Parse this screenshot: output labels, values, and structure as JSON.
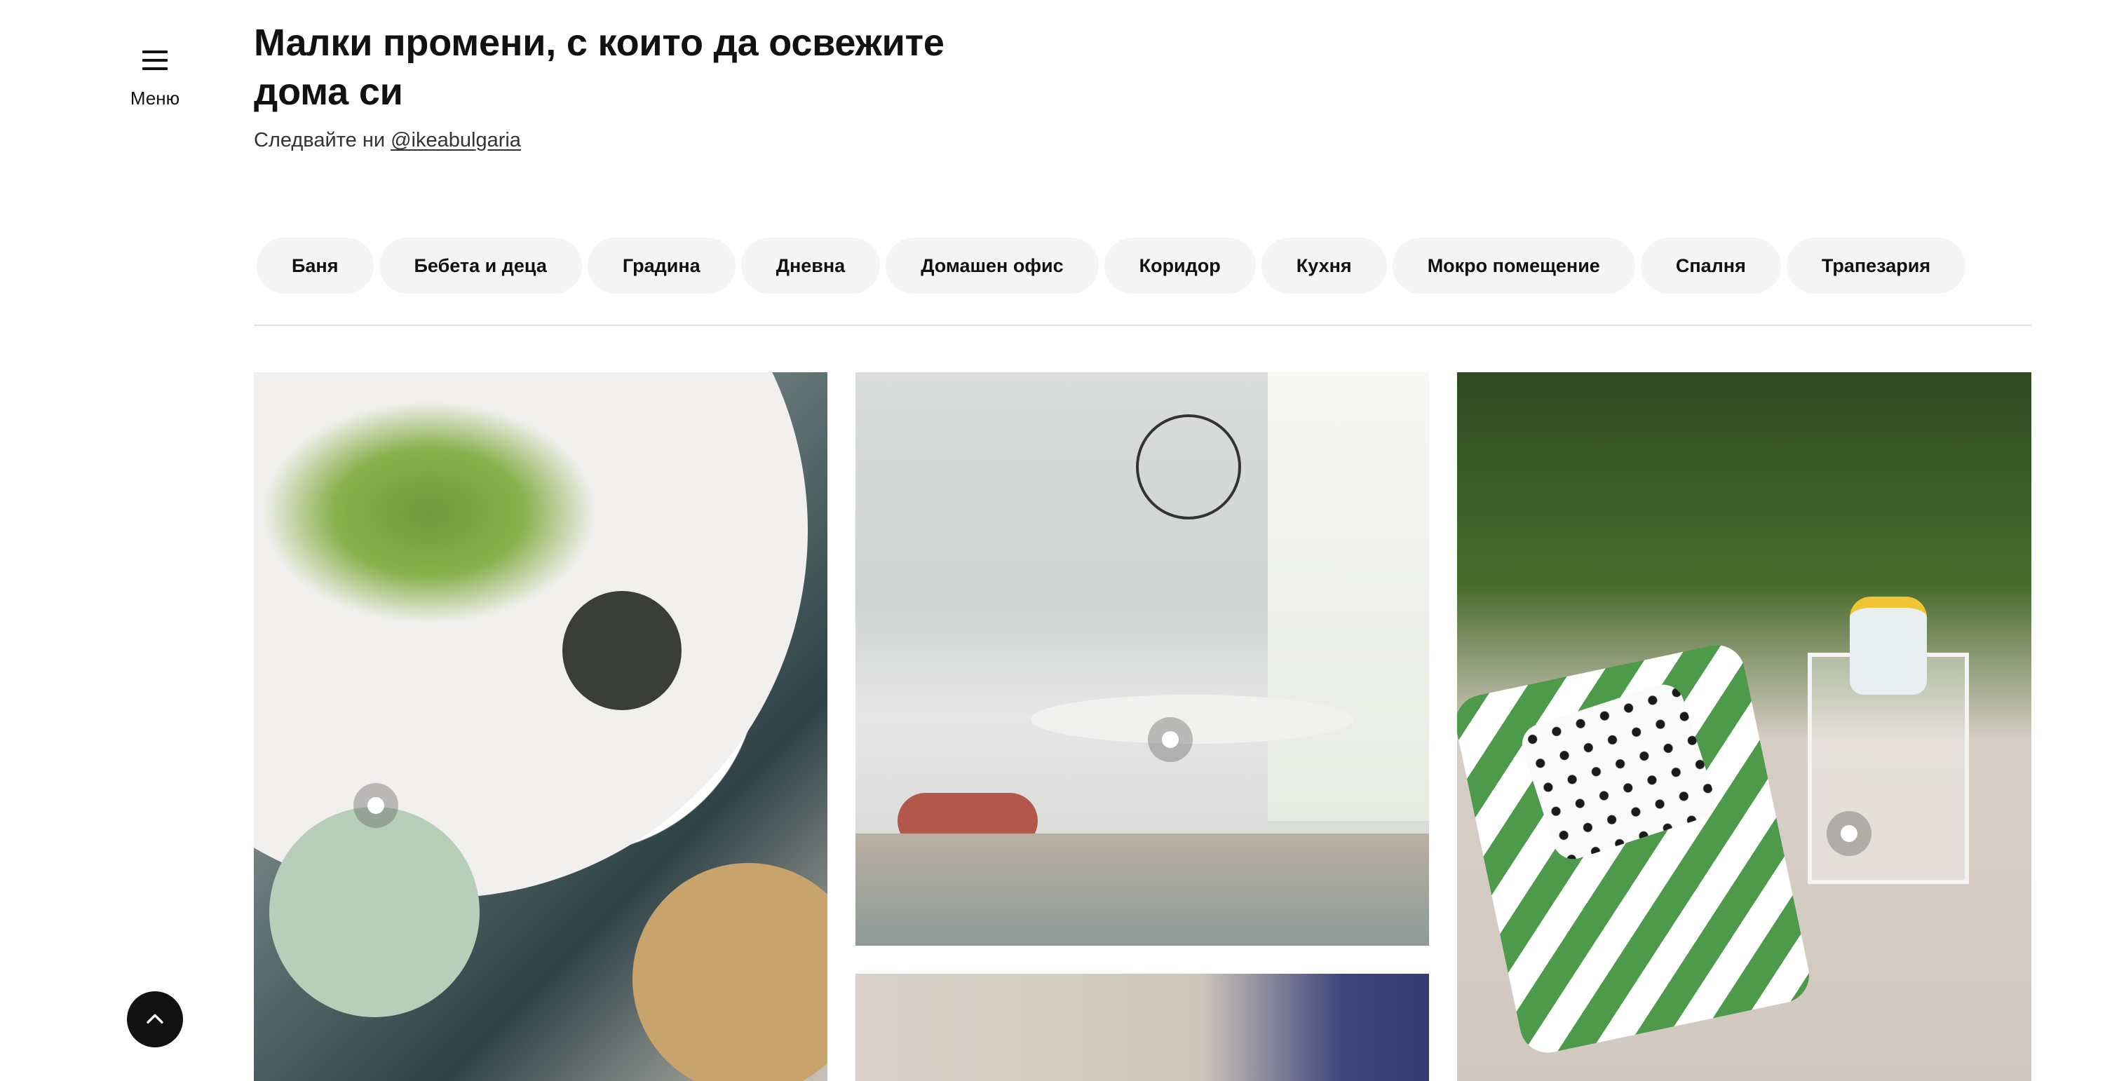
{
  "menu": {
    "label": "Меню",
    "icon": "hamburger-icon"
  },
  "header": {
    "title": "Малки промени, с които да освежите дома си",
    "follow_prefix": "Следвайте ни",
    "handle": "@ikeabulgaria"
  },
  "filters": [
    {
      "label": "Баня"
    },
    {
      "label": "Бебета и деца"
    },
    {
      "label": "Градина"
    },
    {
      "label": "Дневна"
    },
    {
      "label": "Домашен офис"
    },
    {
      "label": "Коридор"
    },
    {
      "label": "Кухня"
    },
    {
      "label": "Мокро помещение"
    },
    {
      "label": "Спалня"
    },
    {
      "label": "Трапезария"
    }
  ],
  "gallery": {
    "tiles": [
      {
        "name": "dining-table-topdown-photo"
      },
      {
        "name": "kitchen-dining-corner-photo"
      },
      {
        "name": "room-photo-partial"
      },
      {
        "name": "balcony-garden-photo"
      }
    ]
  },
  "back_to_top": {
    "icon": "chevron-up-icon"
  }
}
